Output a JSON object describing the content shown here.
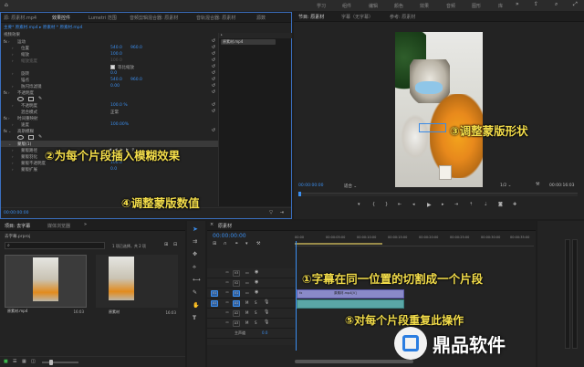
{
  "menu": {
    "items": [
      "学习",
      "组件",
      "编辑",
      "颜色",
      "效果",
      "音频",
      "图形",
      "库"
    ]
  },
  "effect_panel": {
    "tabs": [
      "源: 原素材.mp4",
      "效果控件",
      "Lumetri 范围",
      "音频剪辑混合器: 原素材",
      "音轨混合器: 原素材",
      "源数"
    ],
    "source_line": "主要* 原素材.mp4 ▸ 原素材 * 原素材.mp4",
    "clip_label": "原素材.mp4",
    "section_video": "视频效果",
    "rows": [
      {
        "label": "运动",
        "fx": true
      },
      {
        "label": "位置",
        "v1": "540.0",
        "v2": "960.0"
      },
      {
        "label": "缩放",
        "v1": "100.0"
      },
      {
        "label": "缩放宽度",
        "v1": "100.0"
      },
      {
        "label": "等比缩放",
        "check": true
      },
      {
        "label": "旋转",
        "v1": "0.0"
      },
      {
        "label": "锚点",
        "v1": "540.0",
        "v2": "960.0"
      },
      {
        "label": "防闪烁滤镜",
        "v1": "0.00"
      },
      {
        "label": "不透明度",
        "fx": true
      },
      {
        "label": "shapes"
      },
      {
        "label": "不透明度",
        "v1": "100.0 %"
      },
      {
        "label": "混合模式",
        "v1": "正常"
      },
      {
        "label": "时间重映射",
        "fx": true
      },
      {
        "label": "速度",
        "v1": "100.00%"
      },
      {
        "label": "高斯模糊",
        "fx": true
      },
      {
        "label": "shapes"
      },
      {
        "label": "蒙版(1)",
        "highlight": true
      },
      {
        "label": "蒙版路径"
      },
      {
        "label": "蒙版羽化",
        "v1": "10.0"
      },
      {
        "label": "蒙版不透明度",
        "v1": "100.0"
      },
      {
        "label": "蒙版扩展",
        "v1": "0.0"
      }
    ],
    "timecode": "00:00:00:00"
  },
  "program": {
    "tabs": [
      "节目: 原素材",
      "字幕（无字幕）",
      "参考: 原素材"
    ],
    "timecode_left": "00:00:00:00",
    "fit": "适合",
    "ratio": "1/2",
    "timecode_right": "00:00:16:03"
  },
  "project": {
    "tabs": [
      "项目: 去字幕",
      "媒体浏览器"
    ],
    "filename": "去字幕.prproj",
    "count": "1 项已选择，共 2 项",
    "items": [
      {
        "name": "原素材.mp4",
        "dur": "16:03"
      },
      {
        "name": "原素材",
        "dur": "16:03"
      }
    ]
  },
  "timeline": {
    "tab": "原素材",
    "timecode": "00:00:00:00",
    "ruler": [
      "00:00",
      "00:00:05:00",
      "00:00:10:00",
      "00:00:15:00",
      "00:00:20:00",
      "00:00:25:00",
      "00:00:30:00",
      "00:00:35:00"
    ],
    "tracks": [
      "V3",
      "V2",
      "V1",
      "A1",
      "A2",
      "A3"
    ],
    "src_tracks": [
      "V1",
      "A1"
    ],
    "master": "主声道",
    "master_val": "0.0",
    "clip_label": "原素材.mp4[V]"
  },
  "annotations": {
    "a1": "①字幕在同一位置的切割成一个片段",
    "a2": "②为每个片段插入模糊效果",
    "a3": "③调整蒙版形状",
    "a4": "④调整蒙版数值",
    "a5": "⑤对每个片段重复此操作"
  },
  "watermark": {
    "text": "鼎品软件"
  }
}
